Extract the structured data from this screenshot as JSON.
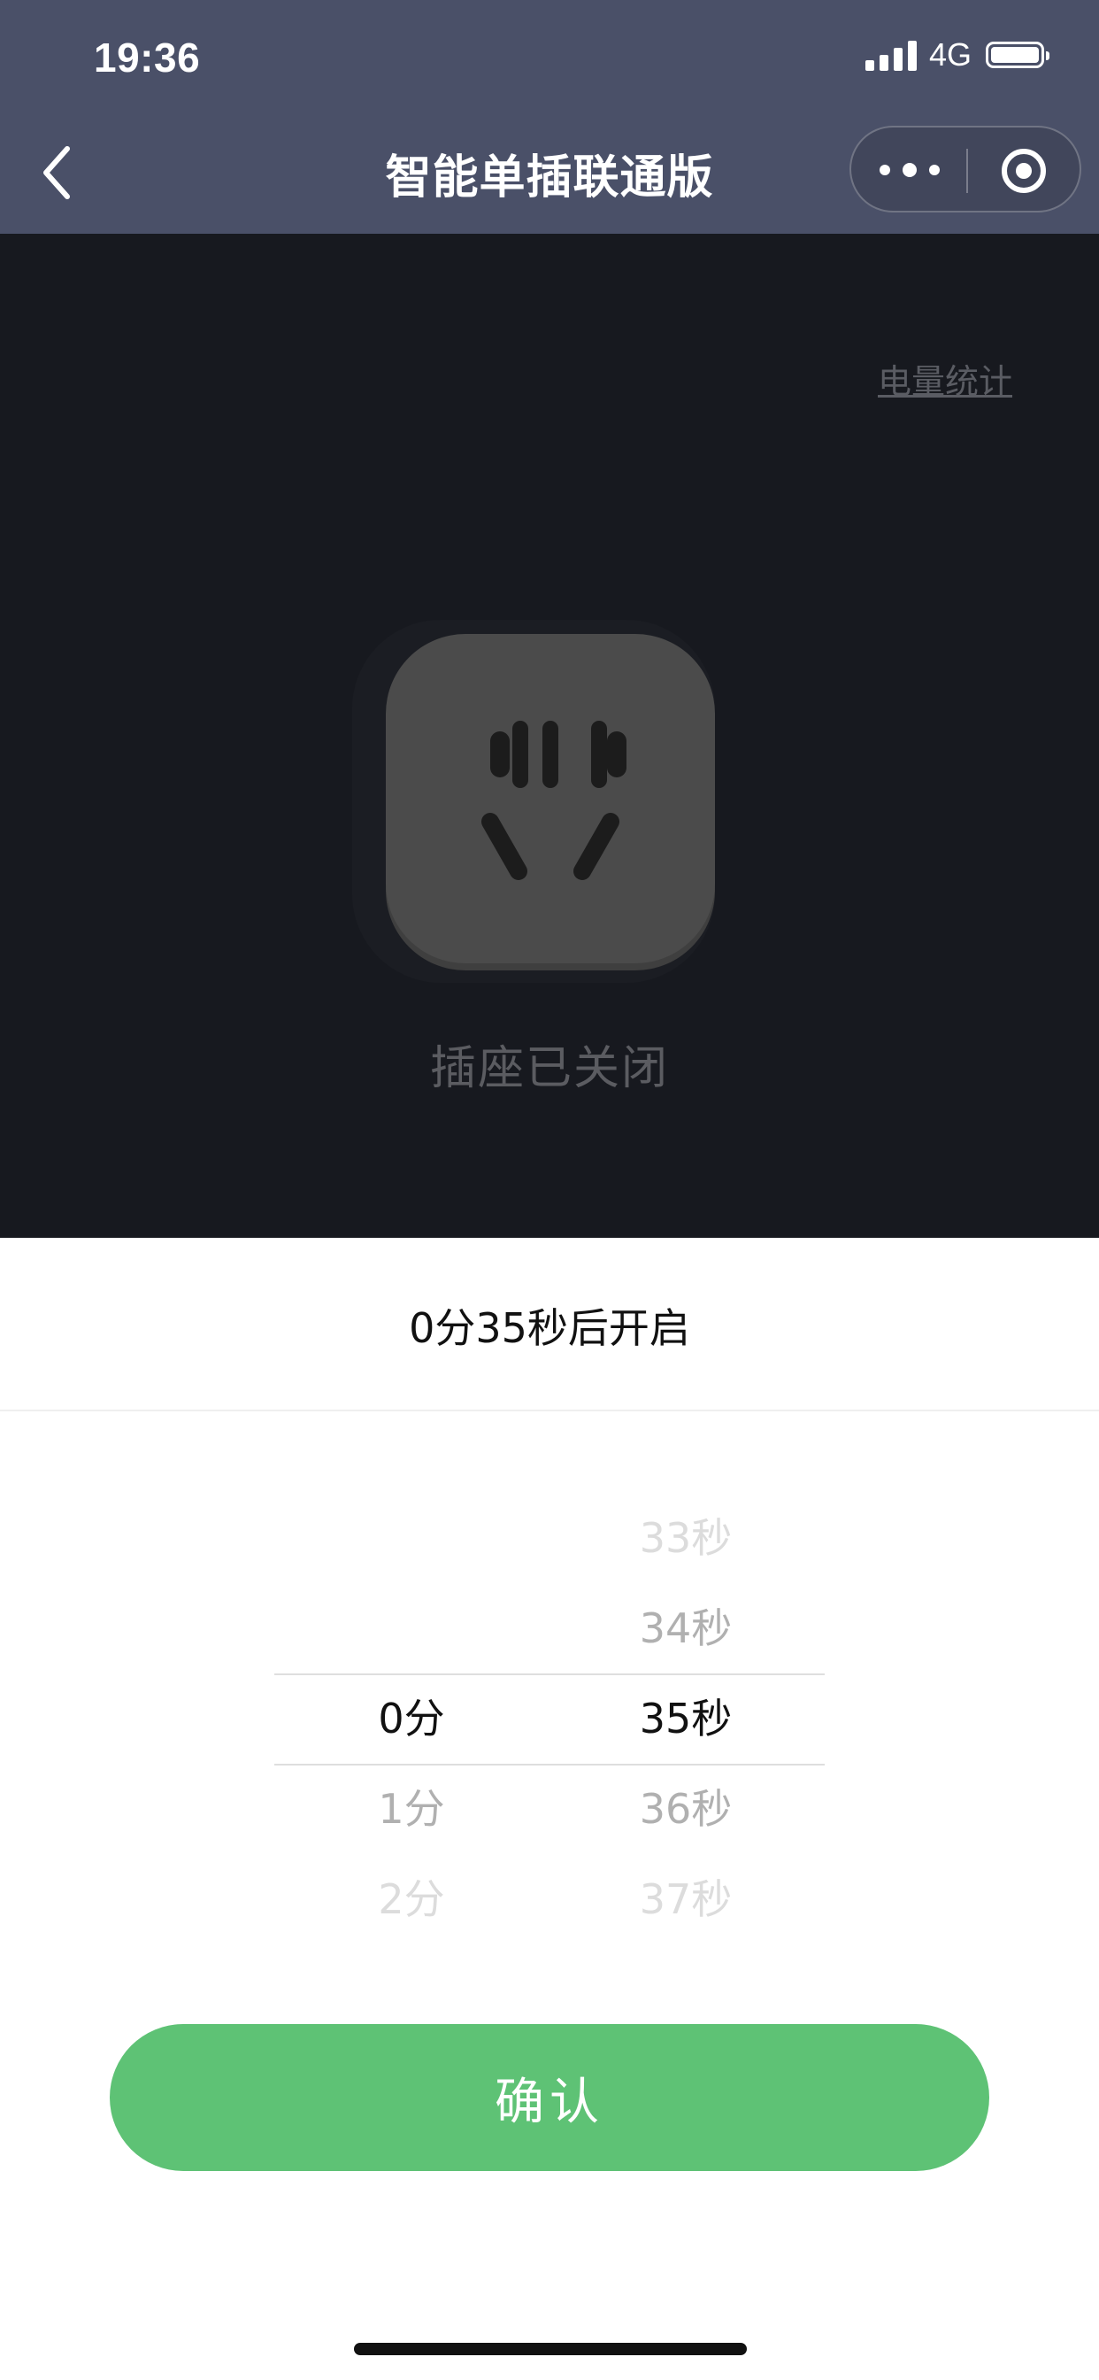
{
  "status_bar": {
    "time": "19:36",
    "network": "4G"
  },
  "nav": {
    "title": "智能单插联通版"
  },
  "device": {
    "stats_link": "电量统计",
    "socket_status": "插座已关闭"
  },
  "timer_sheet": {
    "title": "0分35秒后开启",
    "minutes": [
      "0分",
      "1分",
      "2分"
    ],
    "seconds": [
      "33秒",
      "34秒",
      "35秒",
      "36秒",
      "37秒"
    ],
    "selected_minute": "0分",
    "selected_second": "35秒",
    "confirm_label": "确认"
  },
  "colors": {
    "header_bg": "#4a5068",
    "device_bg": "#17191f",
    "socket_fill": "#4b4b4b",
    "confirm_bg": "#5ec275"
  }
}
